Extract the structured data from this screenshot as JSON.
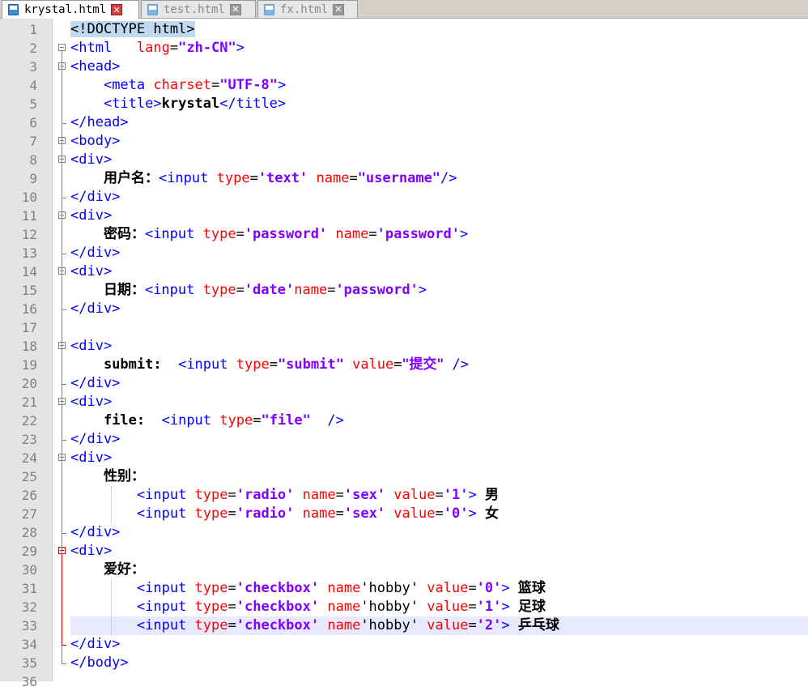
{
  "tabs": [
    {
      "name": "krystal.html",
      "active": true
    },
    {
      "name": "test.html",
      "active": false
    },
    {
      "name": "fx.html",
      "active": false
    }
  ],
  "colors": {
    "tag": "#0000ff",
    "attr": "#ff0000",
    "value": "#8000ff",
    "current_line": "#e8e8ff",
    "fold_active": "#cc0000"
  },
  "lines": [
    {
      "n": "1",
      "parts": [
        [
          "doc",
          "<!DOCTYPE html>"
        ]
      ]
    },
    {
      "n": "2",
      "parts": [
        [
          "tag",
          "<html"
        ],
        [
          "plain",
          "   "
        ],
        [
          "attr",
          "lang"
        ],
        [
          "plain",
          "="
        ],
        [
          "val",
          "\"zh-CN\""
        ],
        [
          "tag",
          ">"
        ]
      ]
    },
    {
      "n": "3",
      "parts": [
        [
          "tag",
          "<head>"
        ]
      ]
    },
    {
      "n": "4",
      "parts": [
        [
          "plain",
          "    "
        ],
        [
          "tag",
          "<meta "
        ],
        [
          "attr",
          "charset"
        ],
        [
          "plain",
          "="
        ],
        [
          "val",
          "\"UTF-8\""
        ],
        [
          "tag",
          ">"
        ]
      ]
    },
    {
      "n": "5",
      "parts": [
        [
          "plain",
          "    "
        ],
        [
          "tag",
          "<title>"
        ],
        [
          "txt",
          "krystal"
        ],
        [
          "tag",
          "</title>"
        ]
      ]
    },
    {
      "n": "6",
      "parts": [
        [
          "tag",
          "</head>"
        ]
      ]
    },
    {
      "n": "7",
      "parts": [
        [
          "tag",
          "<body>"
        ]
      ]
    },
    {
      "n": "8",
      "parts": [
        [
          "tag",
          "<div>"
        ]
      ]
    },
    {
      "n": "9",
      "parts": [
        [
          "plain",
          "    "
        ],
        [
          "txt",
          "用户名："
        ],
        [
          "tag",
          "<input "
        ],
        [
          "attr",
          "type"
        ],
        [
          "plain",
          "="
        ],
        [
          "val",
          "'text'"
        ],
        [
          "plain",
          " "
        ],
        [
          "attr",
          "name"
        ],
        [
          "plain",
          "="
        ],
        [
          "val",
          "\"username\""
        ],
        [
          "tag",
          "/>"
        ]
      ]
    },
    {
      "n": "10",
      "parts": [
        [
          "tag",
          "</div>"
        ]
      ]
    },
    {
      "n": "11",
      "parts": [
        [
          "tag",
          "<div>"
        ]
      ]
    },
    {
      "n": "12",
      "parts": [
        [
          "plain",
          "    "
        ],
        [
          "txt",
          "密码："
        ],
        [
          "tag",
          "<input "
        ],
        [
          "attr",
          "type"
        ],
        [
          "plain",
          "="
        ],
        [
          "val",
          "'password'"
        ],
        [
          "plain",
          " "
        ],
        [
          "attr",
          "name"
        ],
        [
          "plain",
          "="
        ],
        [
          "val",
          "'password'"
        ],
        [
          "tag",
          ">"
        ]
      ]
    },
    {
      "n": "13",
      "parts": [
        [
          "tag",
          "</div>"
        ]
      ]
    },
    {
      "n": "14",
      "parts": [
        [
          "tag",
          "<div>"
        ]
      ]
    },
    {
      "n": "15",
      "parts": [
        [
          "plain",
          "    "
        ],
        [
          "txt",
          "日期："
        ],
        [
          "tag",
          "<input "
        ],
        [
          "attr",
          "type"
        ],
        [
          "plain",
          "="
        ],
        [
          "val",
          "'date'"
        ],
        [
          "attr",
          "name"
        ],
        [
          "plain",
          "="
        ],
        [
          "val",
          "'password'"
        ],
        [
          "tag",
          ">"
        ]
      ]
    },
    {
      "n": "16",
      "parts": [
        [
          "tag",
          "</div>"
        ]
      ]
    },
    {
      "n": "17",
      "parts": []
    },
    {
      "n": "18",
      "parts": [
        [
          "tag",
          "<div>"
        ]
      ]
    },
    {
      "n": "19",
      "parts": [
        [
          "plain",
          "    "
        ],
        [
          "txt",
          "submit:  "
        ],
        [
          "tag",
          "<input "
        ],
        [
          "attr",
          "type"
        ],
        [
          "plain",
          "="
        ],
        [
          "val",
          "\"submit\""
        ],
        [
          "plain",
          " "
        ],
        [
          "attr",
          "value"
        ],
        [
          "plain",
          "="
        ],
        [
          "val",
          "\"提交\""
        ],
        [
          "plain",
          " "
        ],
        [
          "tag",
          "/>"
        ]
      ]
    },
    {
      "n": "20",
      "parts": [
        [
          "tag",
          "</div>"
        ]
      ]
    },
    {
      "n": "21",
      "parts": [
        [
          "tag",
          "<div>"
        ]
      ]
    },
    {
      "n": "22",
      "parts": [
        [
          "plain",
          "    "
        ],
        [
          "txt",
          "file:  "
        ],
        [
          "tag",
          "<input "
        ],
        [
          "attr",
          "type"
        ],
        [
          "plain",
          "="
        ],
        [
          "val",
          "\"file\""
        ],
        [
          "plain",
          "  "
        ],
        [
          "tag",
          "/>"
        ]
      ]
    },
    {
      "n": "23",
      "parts": [
        [
          "tag",
          "</div>"
        ]
      ]
    },
    {
      "n": "24",
      "parts": [
        [
          "tag",
          "<div>"
        ]
      ]
    },
    {
      "n": "25",
      "parts": [
        [
          "plain",
          "    "
        ],
        [
          "txt",
          "性别："
        ]
      ]
    },
    {
      "n": "26",
      "parts": [
        [
          "plain",
          "        "
        ],
        [
          "tag",
          "<input "
        ],
        [
          "attr",
          "type"
        ],
        [
          "plain",
          "="
        ],
        [
          "val",
          "'radio'"
        ],
        [
          "plain",
          " "
        ],
        [
          "attr",
          "name"
        ],
        [
          "plain",
          "="
        ],
        [
          "val",
          "'sex'"
        ],
        [
          "plain",
          " "
        ],
        [
          "attr",
          "value"
        ],
        [
          "plain",
          "="
        ],
        [
          "val",
          "'1'"
        ],
        [
          "tag",
          ">"
        ],
        [
          "plain",
          " "
        ],
        [
          "txt",
          "男"
        ]
      ]
    },
    {
      "n": "27",
      "parts": [
        [
          "plain",
          "        "
        ],
        [
          "tag",
          "<input "
        ],
        [
          "attr",
          "type"
        ],
        [
          "plain",
          "="
        ],
        [
          "val",
          "'radio'"
        ],
        [
          "plain",
          " "
        ],
        [
          "attr",
          "name"
        ],
        [
          "plain",
          "="
        ],
        [
          "val",
          "'sex'"
        ],
        [
          "plain",
          " "
        ],
        [
          "attr",
          "value"
        ],
        [
          "plain",
          "="
        ],
        [
          "val",
          "'0'"
        ],
        [
          "tag",
          ">"
        ],
        [
          "plain",
          " "
        ],
        [
          "txt",
          "女"
        ]
      ]
    },
    {
      "n": "28",
      "parts": [
        [
          "tag",
          "</div>"
        ]
      ]
    },
    {
      "n": "29",
      "parts": [
        [
          "tag",
          "<div>"
        ]
      ]
    },
    {
      "n": "30",
      "parts": [
        [
          "plain",
          "    "
        ],
        [
          "txt",
          "爱好："
        ]
      ]
    },
    {
      "n": "31",
      "parts": [
        [
          "plain",
          "        "
        ],
        [
          "tag",
          "<input "
        ],
        [
          "attr",
          "type"
        ],
        [
          "plain",
          "="
        ],
        [
          "val",
          "'checkbox'"
        ],
        [
          "plain",
          " "
        ],
        [
          "attr",
          "name"
        ],
        [
          "plain",
          "'hobby' "
        ],
        [
          "attr",
          "value"
        ],
        [
          "plain",
          "="
        ],
        [
          "val",
          "'0'"
        ],
        [
          "tag",
          ">"
        ],
        [
          "plain",
          " "
        ],
        [
          "txt",
          "篮球"
        ]
      ]
    },
    {
      "n": "32",
      "parts": [
        [
          "plain",
          "        "
        ],
        [
          "tag",
          "<input "
        ],
        [
          "attr",
          "type"
        ],
        [
          "plain",
          "="
        ],
        [
          "val",
          "'checkbox'"
        ],
        [
          "plain",
          " "
        ],
        [
          "attr",
          "name"
        ],
        [
          "plain",
          "'hobby' "
        ],
        [
          "attr",
          "value"
        ],
        [
          "plain",
          "="
        ],
        [
          "val",
          "'1'"
        ],
        [
          "tag",
          ">"
        ],
        [
          "plain",
          " "
        ],
        [
          "txt",
          "足球"
        ]
      ]
    },
    {
      "n": "33",
      "parts": [
        [
          "plain",
          "        "
        ],
        [
          "tag",
          "<input "
        ],
        [
          "attr",
          "type"
        ],
        [
          "plain",
          "="
        ],
        [
          "val",
          "'checkbox'"
        ],
        [
          "plain",
          " "
        ],
        [
          "attr",
          "name"
        ],
        [
          "plain",
          "'hobby' "
        ],
        [
          "attr",
          "value"
        ],
        [
          "plain",
          "="
        ],
        [
          "val",
          "'2'"
        ],
        [
          "tag",
          ">"
        ],
        [
          "plain",
          " "
        ],
        [
          "txt",
          "乒乓球"
        ]
      ]
    },
    {
      "n": "34",
      "parts": [
        [
          "tag",
          "</div>"
        ]
      ]
    },
    {
      "n": "35",
      "parts": [
        [
          "tag",
          "</body>"
        ]
      ]
    },
    {
      "n": "36",
      "parts": []
    }
  ],
  "current_line": "33"
}
